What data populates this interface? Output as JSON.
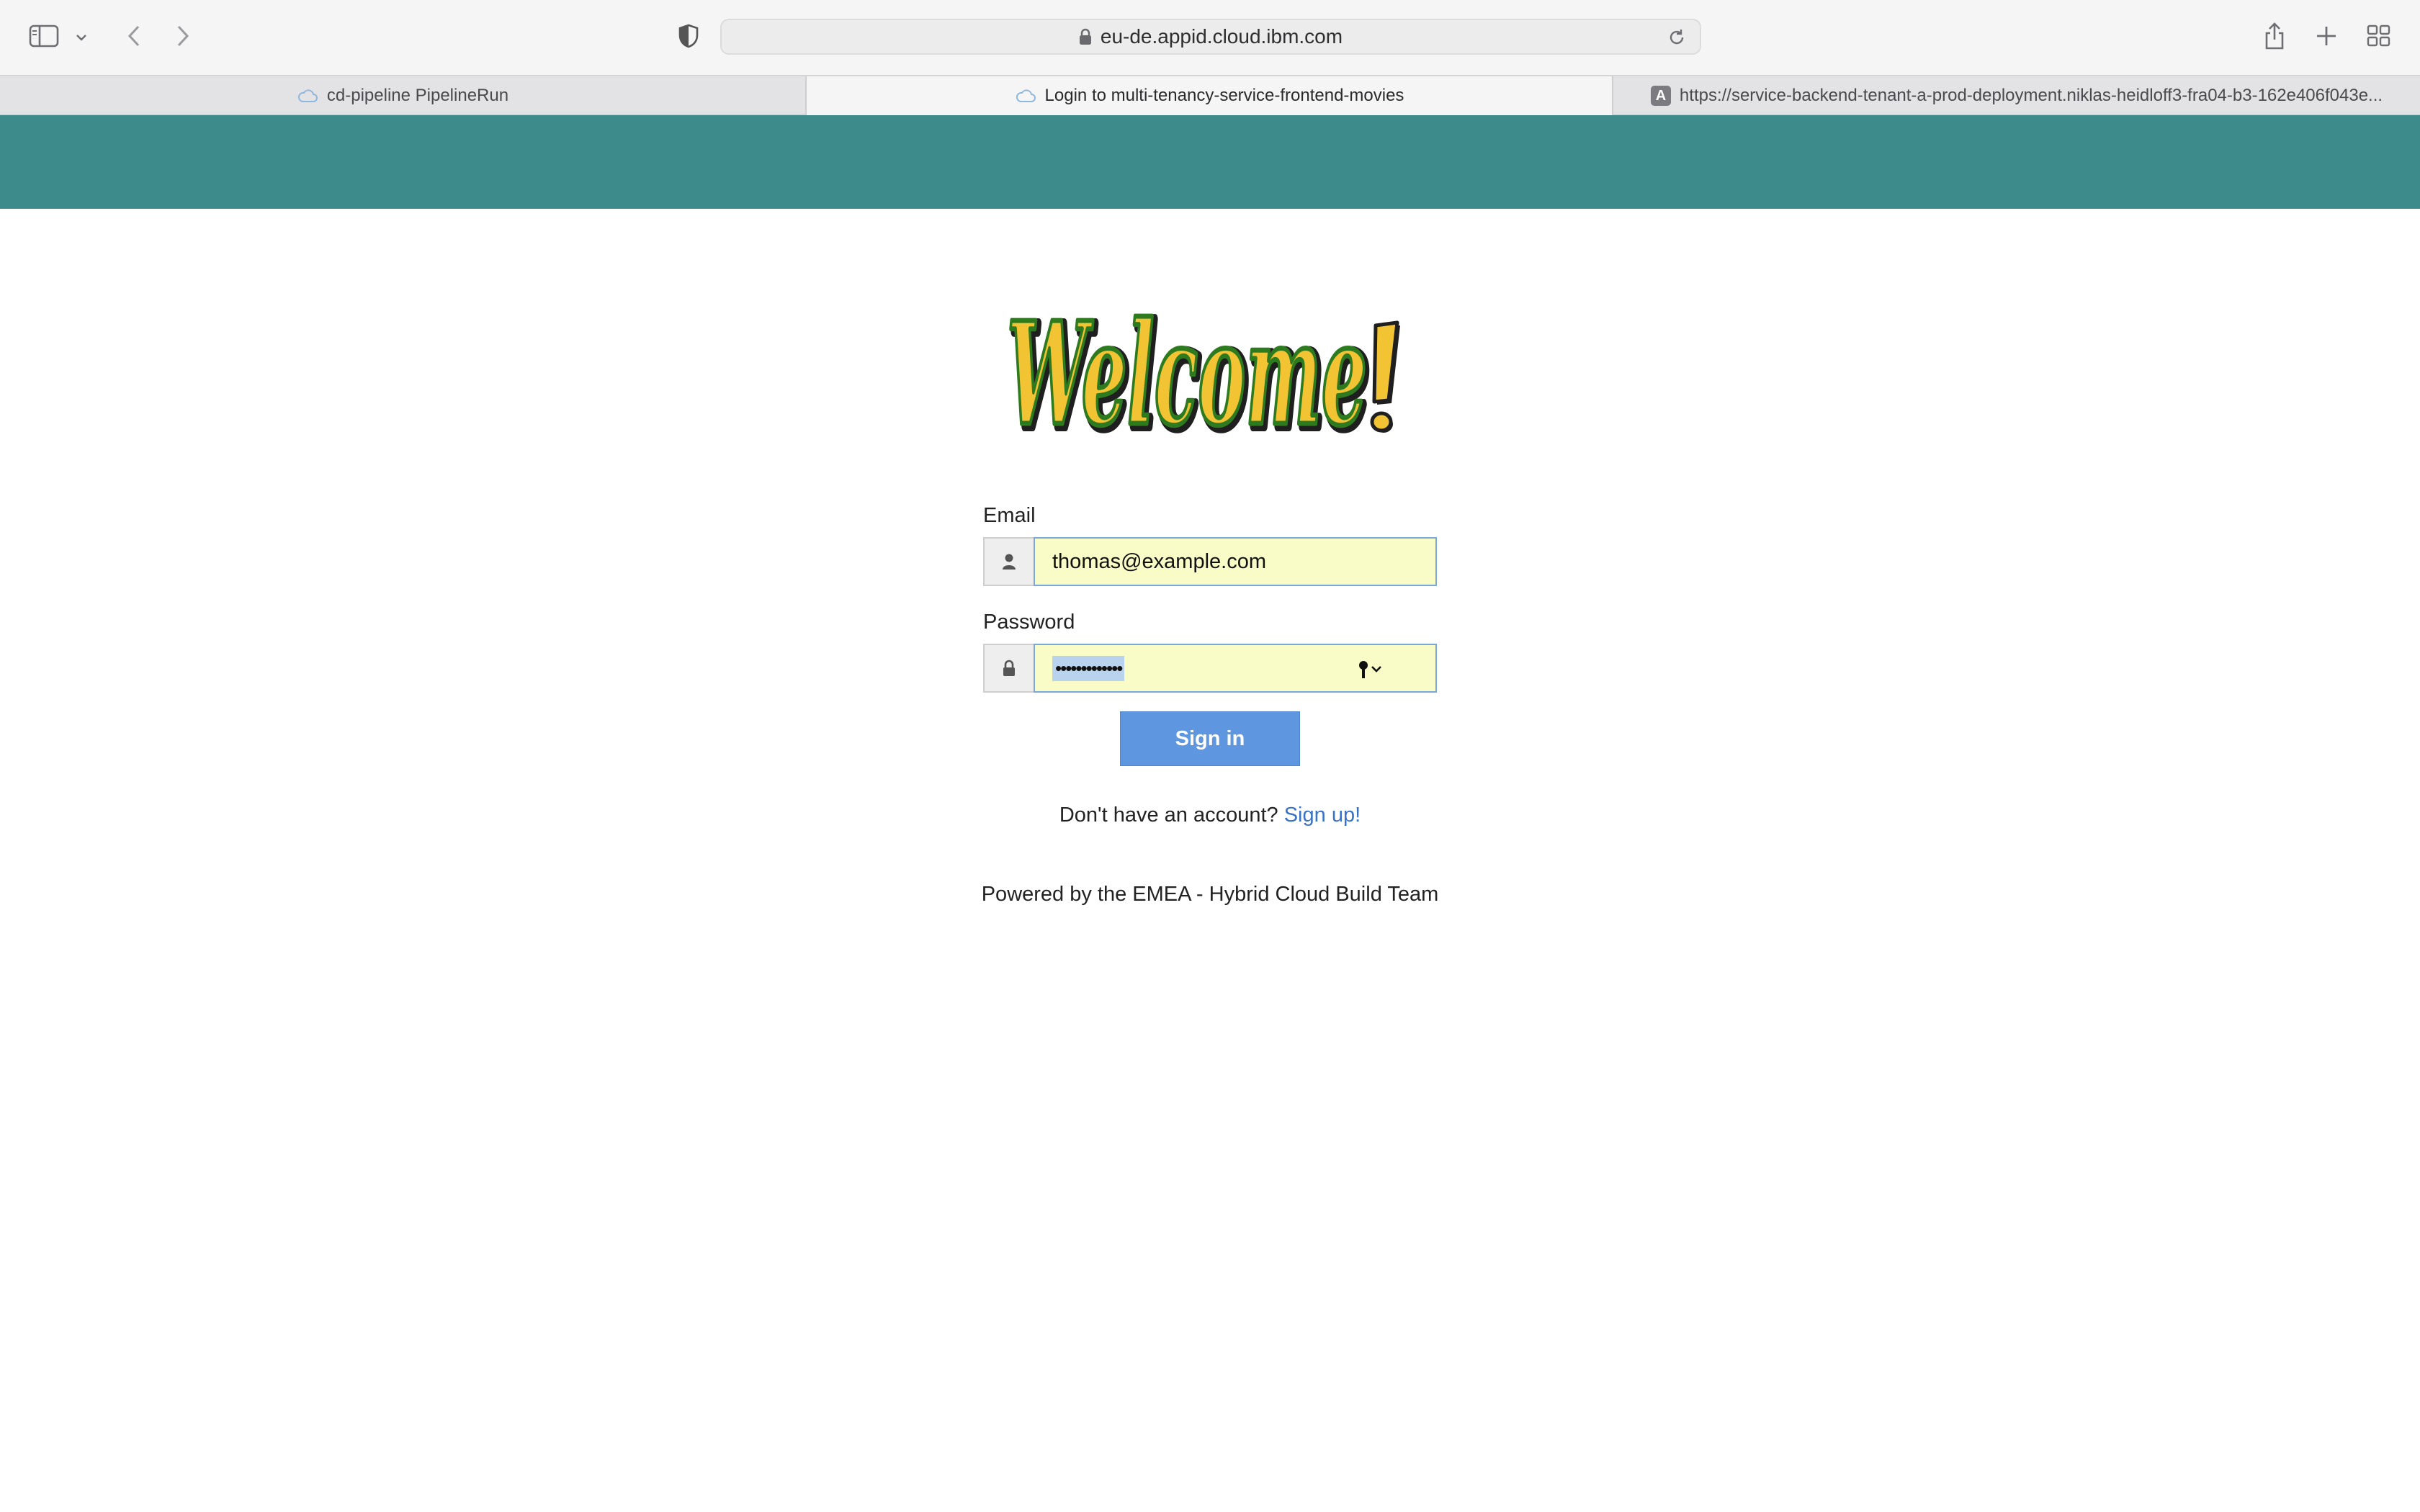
{
  "browser": {
    "url": "eu-de.appid.cloud.ibm.com",
    "tabs": [
      {
        "title": "cd-pipeline PipelineRun",
        "favicon": "cloud-icon",
        "active": false
      },
      {
        "title": "Login to multi-tenancy-service-frontend-movies",
        "favicon": "cloud-icon",
        "active": true
      },
      {
        "title": "https://service-backend-tenant-a-prod-deployment.niklas-heidloff3-fra04-b3-162e406f043e...",
        "favicon": "a-letter-icon",
        "active": false
      }
    ],
    "favicon_letter": "A"
  },
  "page": {
    "header_color": "#3d8b8b",
    "welcome_text": "Welcome!",
    "form": {
      "email_label": "Email",
      "email_value": "thomas@example.com",
      "password_label": "Password",
      "password_value": "•••••••••••••",
      "signin_label": "Sign in",
      "signin_color": "#5f96e0"
    },
    "signup_prompt": "Don't have an account?",
    "signup_link": "Sign up!",
    "powered_by": "Powered by the EMEA - Hybrid Cloud Build Team"
  },
  "colors": {
    "input_autofill_bg": "#fafcc8",
    "link": "#3a73c6",
    "welcome_fill": "#f2c434",
    "welcome_outline": "#2e7a1f"
  }
}
